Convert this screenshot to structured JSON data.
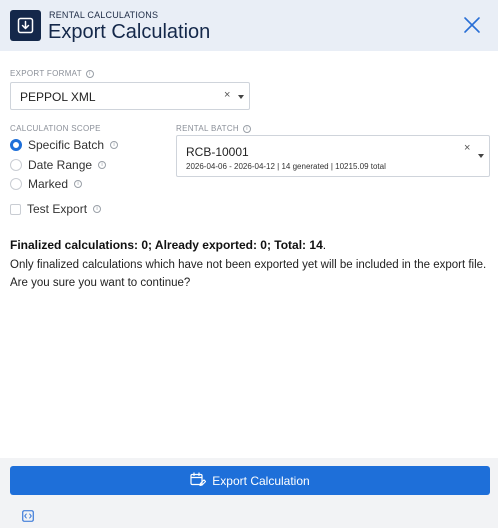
{
  "header": {
    "subtitle": "RENTAL CALCULATIONS",
    "title": "Export Calculation",
    "icon": "download-box-icon",
    "close_icon": "close-icon"
  },
  "export_format": {
    "label": "EXPORT FORMAT",
    "value": "PEPPOL XML",
    "clear": "×"
  },
  "scope": {
    "label": "CALCULATION SCOPE",
    "options": [
      {
        "label": "Specific Batch",
        "selected": true
      },
      {
        "label": "Date Range",
        "selected": false
      },
      {
        "label": "Marked",
        "selected": false
      }
    ]
  },
  "test_export": {
    "label": "Test Export",
    "checked": false
  },
  "rental_batch": {
    "label": "RENTAL BATCH",
    "id": "RCB-10001",
    "detail": "2026-04-06 - 2026-04-12 | 14 generated | 10215.09 total",
    "clear": "×"
  },
  "summary": {
    "text": "Finalized calculations: 0; Already exported: 0; Total: 14",
    "period": "."
  },
  "message": "Only finalized calculations which have not been exported yet will be included in the export file. Are you sure you want to continue?",
  "footer": {
    "export_label": "Export Calculation",
    "export_icon": "calendar-edit-icon",
    "code_icon": "code-icon"
  },
  "colors": {
    "accent": "#1e6fd9",
    "header_bg": "#e9eef6",
    "header_icon_bg": "#14284a"
  }
}
